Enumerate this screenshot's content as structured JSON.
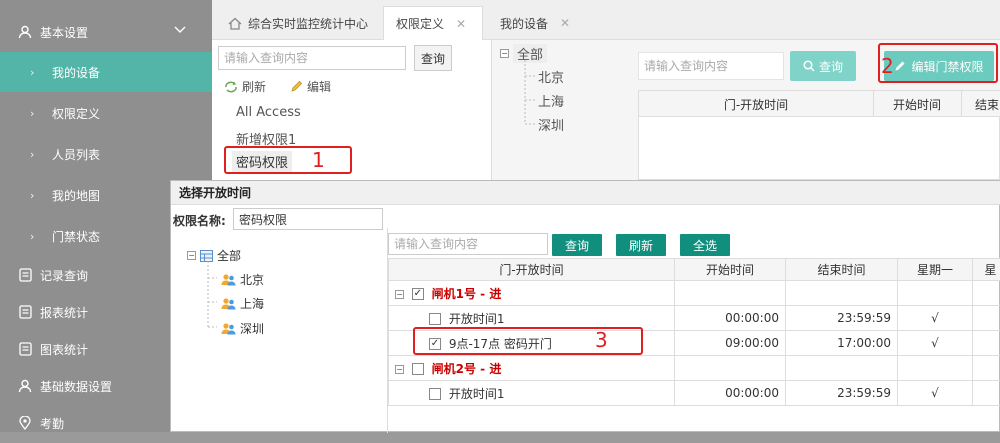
{
  "sidebar": {
    "items": [
      {
        "label": "基本设置",
        "type": "top",
        "icon": "user-icon",
        "expanded": true
      },
      {
        "label": "我的设备",
        "type": "sub",
        "active": true
      },
      {
        "label": "权限定义",
        "type": "sub"
      },
      {
        "label": "人员列表",
        "type": "sub"
      },
      {
        "label": "我的地图",
        "type": "sub"
      },
      {
        "label": "门禁状态",
        "type": "sub"
      },
      {
        "label": "记录查询",
        "type": "top",
        "icon": "document-icon"
      },
      {
        "label": "报表统计",
        "type": "top",
        "icon": "document-icon"
      },
      {
        "label": "图表统计",
        "type": "top",
        "icon": "document-icon"
      },
      {
        "label": "基础数据设置",
        "type": "top",
        "icon": "user-icon"
      },
      {
        "label": "考勤",
        "type": "top",
        "icon": "location-icon"
      }
    ]
  },
  "tabs": [
    {
      "label": "综合实时监控统计中心",
      "icon": "home-icon"
    },
    {
      "label": "权限定义",
      "active": true,
      "close": "✕"
    },
    {
      "label": "我的设备",
      "close": "✕"
    }
  ],
  "permission_panel": {
    "search_placeholder": "请输入查询内容",
    "search_button": "查询",
    "refresh_label": "刷新",
    "edit_label": "编辑",
    "items": [
      "All Access",
      "新增权限1",
      "密码权限"
    ],
    "marker_1": "1"
  },
  "device_tree": {
    "root": "全部",
    "children": [
      "北京",
      "上海",
      "深圳"
    ]
  },
  "right_panel": {
    "search_placeholder": "请输入查询内容",
    "search_button": "查询",
    "edit_door_button": "编辑门禁权限",
    "marker_2": "2",
    "columns": [
      "门-开放时间",
      "开始时间",
      "结束"
    ]
  },
  "dialog": {
    "title": "选择开放时间",
    "name_label": "权限名称:",
    "name_value": "密码权限",
    "tree_root": "全部",
    "tree_children": [
      "北京",
      "上海",
      "深圳"
    ],
    "search_placeholder": "请输入查询内容",
    "buttons": {
      "query": "查询",
      "refresh": "刷新",
      "select_all": "全选"
    },
    "columns": [
      "门-开放时间",
      "开始时间",
      "结束时间",
      "星期一",
      "星"
    ],
    "groups": [
      {
        "name": "闸机1号 - 进",
        "checked": true,
        "rows": [
          {
            "name": "开放时间1",
            "checked": false,
            "start": "00:00:00",
            "end": "23:59:59",
            "mon": "√"
          },
          {
            "name": "9点-17点 密码开门",
            "checked": true,
            "start": "09:00:00",
            "end": "17:00:00",
            "mon": "√"
          }
        ]
      },
      {
        "name": "闸机2号 - 进",
        "checked": false,
        "rows": [
          {
            "name": "开放时间1",
            "checked": false,
            "start": "00:00:00",
            "end": "23:59:59",
            "mon": "√"
          }
        ]
      }
    ],
    "marker_3": "3"
  },
  "colors": {
    "accent": "#52b5a8",
    "button_green": "#108f7e",
    "marker_red": "#e02020",
    "group_red": "#cc0000"
  }
}
